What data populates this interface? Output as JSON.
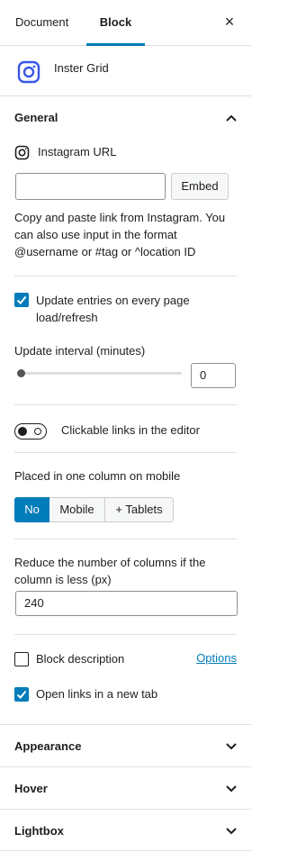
{
  "tabs": {
    "document": "Document",
    "block": "Block",
    "close": "×"
  },
  "block": {
    "title": "Inster Grid",
    "icon": "instagram-icon"
  },
  "general": {
    "title": "General",
    "instagram_url_label": "Instagram URL",
    "instagram_url_value": "",
    "embed_button": "Embed",
    "help_text": "Copy and paste link from Instagram. You can also use input in the format @username or #tag or ^location ID",
    "update_entries_label": "Update entries on every page load/refresh",
    "update_entries_checked": true,
    "update_interval_label": "Update interval (minutes)",
    "update_interval_value": "0",
    "clickable_links_label": "Clickable links in the editor",
    "clickable_links_on": false,
    "one_column_label": "Placed in one column on mobile",
    "one_column_options": [
      "No",
      "Mobile",
      "+ Tablets"
    ],
    "one_column_selected": "No",
    "reduce_columns_label": "Reduce the number of columns if the column is less (px)",
    "reduce_columns_value": "240",
    "block_description_label": "Block description",
    "block_description_checked": false,
    "options_link": "Options",
    "open_links_label": "Open links in a new tab",
    "open_links_checked": true
  },
  "panels": {
    "appearance": "Appearance",
    "hover": "Hover",
    "lightbox": "Lightbox"
  },
  "colors": {
    "accent": "#007cba",
    "text": "#1e1e1e",
    "border": "#e0e0e0"
  }
}
